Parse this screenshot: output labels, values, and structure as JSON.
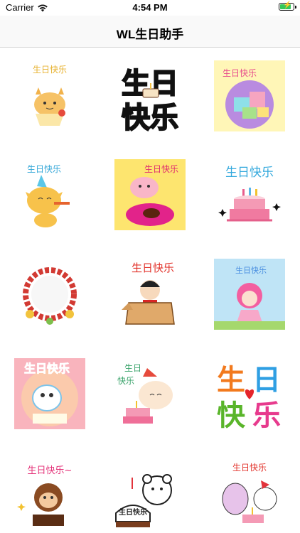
{
  "status_bar": {
    "carrier": "Carrier",
    "time": "4:54 PM"
  },
  "nav": {
    "title": "WL生日助手"
  },
  "stickers": [
    {
      "caption": "生日快乐",
      "icon": "cat-cupcake-icon"
    },
    {
      "caption": "生日快乐",
      "icon": "big-text-cake-icon"
    },
    {
      "caption": "生日快乐",
      "icon": "gift-boxes-icon"
    },
    {
      "caption": "生日快乐",
      "icon": "cow-party-icon"
    },
    {
      "caption": "生日快乐",
      "icon": "pig-cake-icon"
    },
    {
      "caption": "生日快乐",
      "icon": "cake-candles-icon"
    },
    {
      "caption": "",
      "icon": "flower-wreath-icon"
    },
    {
      "caption": "生日快乐",
      "icon": "box-boy-icon"
    },
    {
      "caption": "生日快乐",
      "icon": "fairy-girl-icon"
    },
    {
      "caption": "生日快乐",
      "icon": "seal-cake-icon"
    },
    {
      "caption": "生日快乐",
      "icon": "cat-cake-icon"
    },
    {
      "caption": "生日快乐",
      "icon": "colorful-text-heart-icon"
    },
    {
      "caption": "生日快乐~",
      "icon": "monkey-cake-icon"
    },
    {
      "caption": "生日快乐",
      "icon": "bear-cake-icon"
    },
    {
      "caption": "生日快乐",
      "icon": "friends-cake-icon"
    }
  ]
}
